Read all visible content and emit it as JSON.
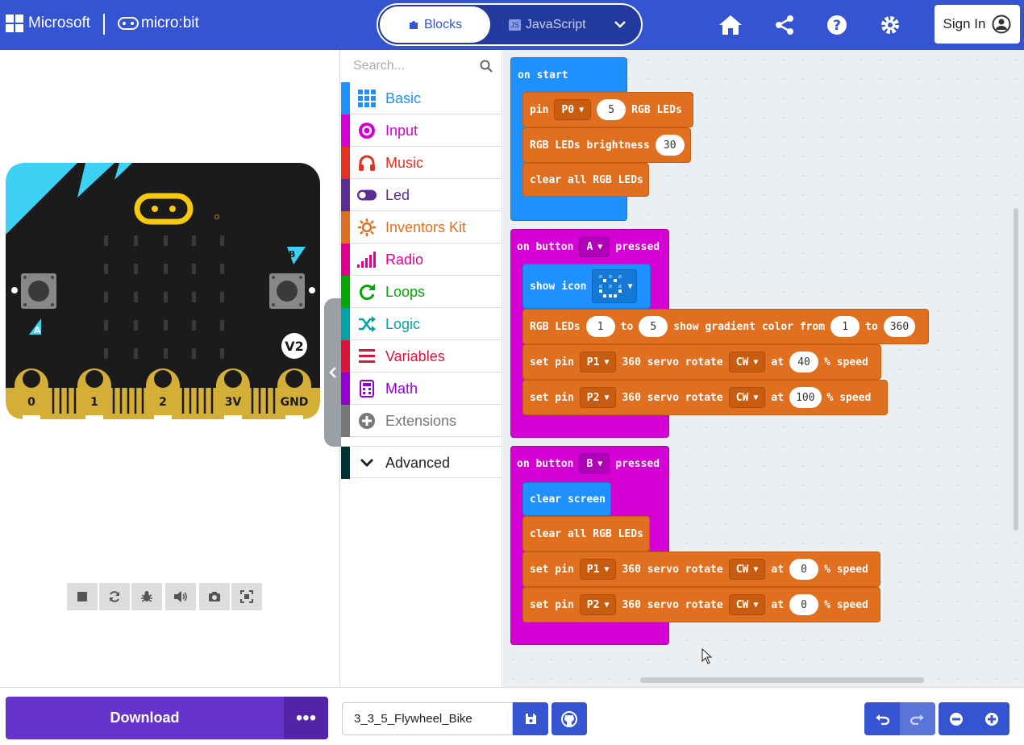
{
  "header": {
    "ms_label": "Microsoft",
    "product": "micro:bit",
    "tabs": {
      "blocks": "Blocks",
      "javascript": "JavaScript",
      "js_badge": "JS"
    },
    "signin": "Sign In"
  },
  "simulator": {
    "pins": [
      "0",
      "1",
      "2",
      "3V",
      "GND"
    ],
    "version": "V2",
    "button_a": "A",
    "button_b": "B"
  },
  "toolbox": {
    "search_placeholder": "Search...",
    "categories": [
      {
        "label": "Basic",
        "color": "#1e90ff"
      },
      {
        "label": "Input",
        "color": "#d400d4"
      },
      {
        "label": "Music",
        "color": "#e63022"
      },
      {
        "label": "Led",
        "color": "#5c2d91"
      },
      {
        "label": "Inventors Kit",
        "color": "#e06f1f"
      },
      {
        "label": "Radio",
        "color": "#e3008c"
      },
      {
        "label": "Loops",
        "color": "#00aa00"
      },
      {
        "label": "Logic",
        "color": "#00a4a6"
      },
      {
        "label": "Variables",
        "color": "#dc143c"
      },
      {
        "label": "Math",
        "color": "#9400d3"
      },
      {
        "label": "Extensions",
        "color": "#777777"
      },
      {
        "label": "Advanced",
        "color": "#003333"
      }
    ]
  },
  "blocks": {
    "on_start": "on start",
    "pin": "pin",
    "p0": "P0",
    "n5": "5",
    "rgb_leds": "RGB LEDs",
    "brightness": "RGB LEDs brightness",
    "n30": "30",
    "clear_rgb": "clear all RGB LEDs",
    "on_button": "on button",
    "btn_a": "A",
    "btn_b": "B",
    "pressed": "pressed",
    "show_icon": "show icon",
    "rgb_leds_lbl": "RGB LEDs",
    "g1": "1",
    "to": "to",
    "g5": "5",
    "show_grad": "show gradient color from",
    "g1b": "1",
    "to2": "to",
    "g360": "360",
    "set_pin": "set pin",
    "p1": "P1",
    "p2": "P2",
    "servo": "360 servo rotate",
    "cw": "CW",
    "at": "at",
    "speed": "% speed",
    "s40": "40",
    "s100": "100",
    "s0a": "0",
    "s0b": "0",
    "clear_screen": "clear screen"
  },
  "bottom": {
    "download": "Download",
    "more": "•••",
    "project_name": "3_3_5_Flywheel_Bike"
  }
}
